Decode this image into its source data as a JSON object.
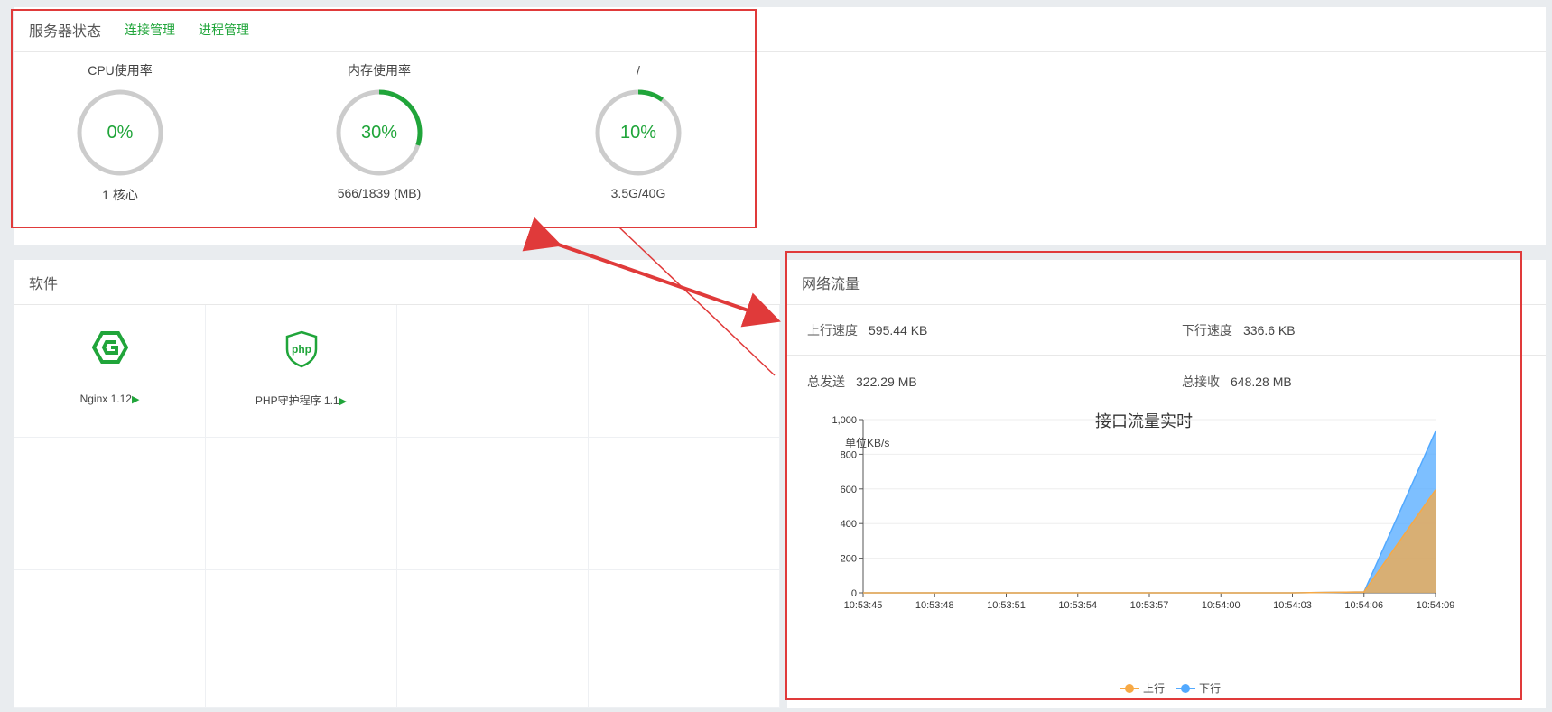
{
  "status": {
    "title": "服务器状态",
    "links": [
      "连接管理",
      "进程管理"
    ],
    "gauges": [
      {
        "title": "CPU使用率",
        "value_label": "0%",
        "percent": 0,
        "sub": "1 核心"
      },
      {
        "title": "内存使用率",
        "value_label": "30%",
        "percent": 30,
        "sub": "566/1839 (MB)"
      },
      {
        "title": "/",
        "value_label": "10%",
        "percent": 10,
        "sub": "3.5G/40G"
      }
    ]
  },
  "software": {
    "title": "软件",
    "items": [
      {
        "name": "Nginx 1.12",
        "icon": "nginx-icon"
      },
      {
        "name": "PHP守护程序 1.1",
        "icon": "php-icon",
        "icon_text": "php"
      }
    ]
  },
  "network": {
    "title": "网络流量",
    "up_speed_label": "上行速度",
    "up_speed": "595.44 KB",
    "down_speed_label": "下行速度",
    "down_speed": "336.6 KB",
    "total_sent_label": "总发送",
    "total_sent": "322.29 MB",
    "total_recv_label": "总接收",
    "total_recv": "648.28 MB"
  },
  "colors": {
    "accent": "#20a53a",
    "up": "#f7a945",
    "down": "#52a9ff",
    "annotation": "#e03a3a"
  },
  "chart_data": {
    "type": "area",
    "title": "接口流量实时",
    "ylabel": "单位KB/s",
    "xlabel": "",
    "ylim": [
      0,
      1000
    ],
    "yticks": [
      "0",
      "200",
      "400",
      "600",
      "800",
      "1,000"
    ],
    "categories": [
      "10:53:45",
      "10:53:48",
      "10:53:51",
      "10:53:54",
      "10:53:57",
      "10:54:00",
      "10:54:03",
      "10:54:06",
      "10:54:09"
    ],
    "series": [
      {
        "name": "上行",
        "values": [
          0,
          0,
          0,
          0,
          0,
          0,
          0,
          5,
          595
        ]
      },
      {
        "name": "下行",
        "values": [
          0,
          0,
          0,
          0,
          0,
          0,
          0,
          5,
          932
        ]
      }
    ],
    "legend": "bottom",
    "grid": true
  }
}
